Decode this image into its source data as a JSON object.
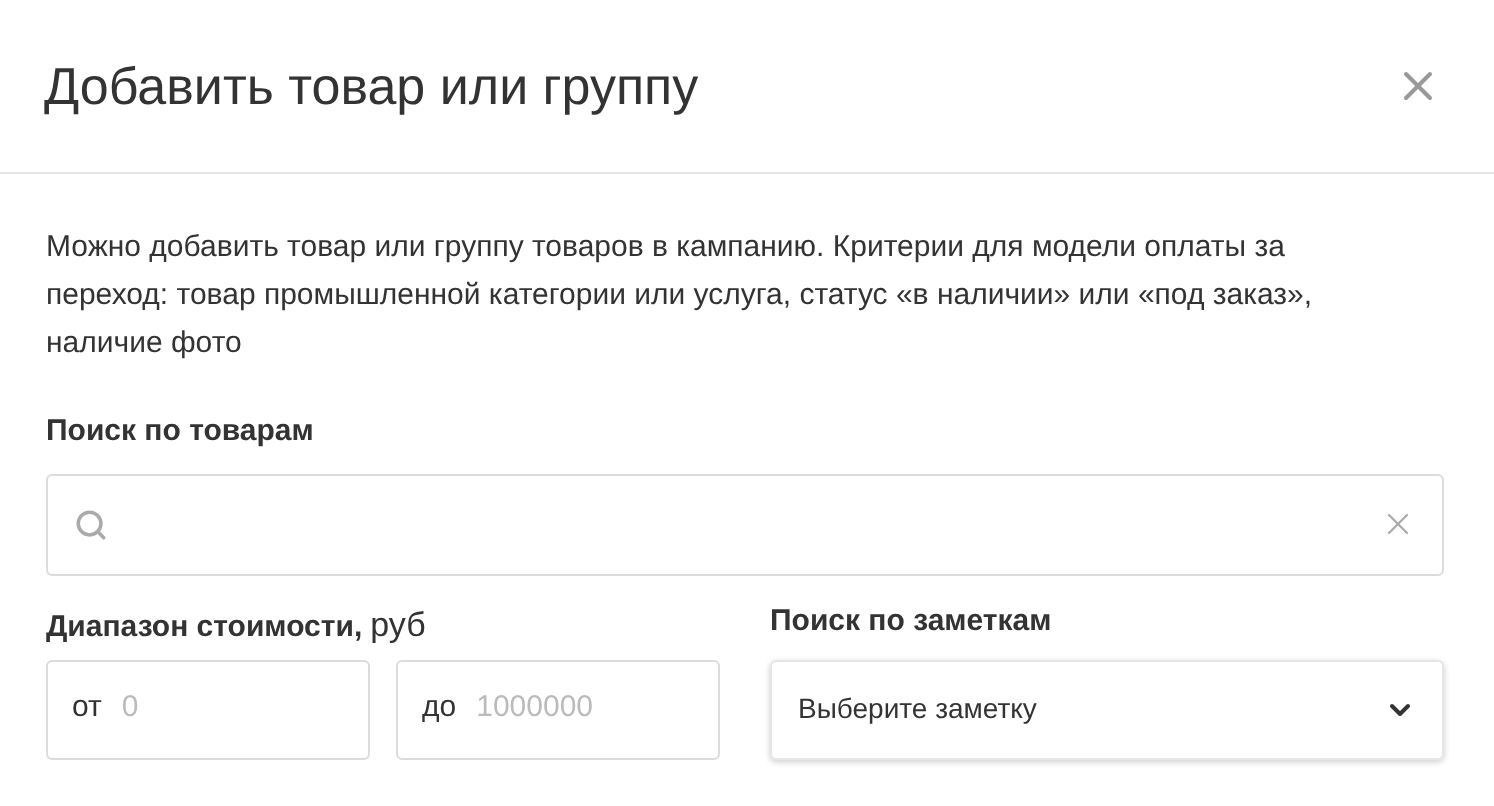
{
  "dialog": {
    "title": "Добавить товар или группу"
  },
  "description": "Можно добавить товар или группу товаров в кампанию. Критерии для модели оплаты за переход: товар промышленной категории или услуга, статус «в наличии» или «под заказ», наличие фото",
  "product_search": {
    "label": "Поиск по товарам"
  },
  "price_range": {
    "label": "Диапазон стоимости,",
    "unit": "руб",
    "fields": [
      {
        "prefix": "от",
        "placeholder": "0"
      },
      {
        "prefix": "до",
        "placeholder": "1000000"
      }
    ]
  },
  "notes_search": {
    "label": "Поиск по заметкам",
    "select": {
      "value": "Выберите заметку"
    }
  }
}
